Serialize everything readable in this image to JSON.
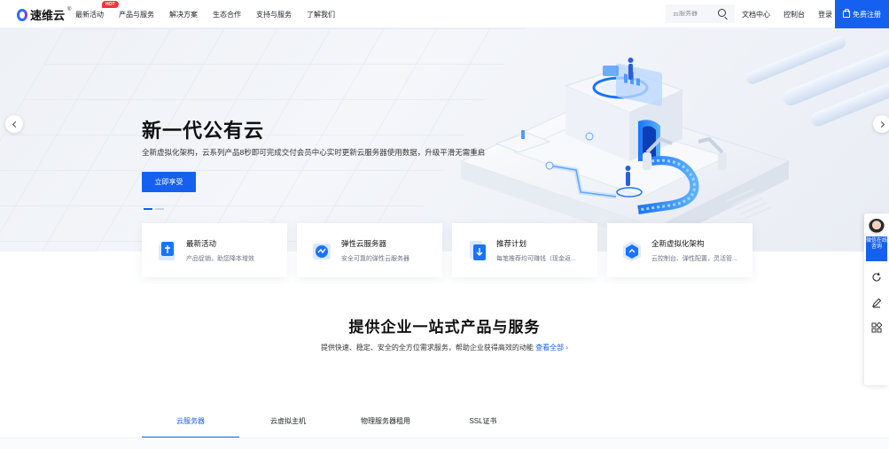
{
  "header": {
    "logo_text": "速维云",
    "logo_mark": "®",
    "nav": [
      {
        "label": "最新活动",
        "badge": "HOT"
      },
      {
        "label": "产品与服务",
        "badge": null
      },
      {
        "label": "解决方案",
        "badge": null
      },
      {
        "label": "生态合作",
        "badge": null
      },
      {
        "label": "支持与服务",
        "badge": null
      },
      {
        "label": "了解我们",
        "badge": null
      }
    ],
    "search_placeholder": "云服务器",
    "docs_label": "文档中心",
    "console_label": "控制台",
    "login_label": "登录",
    "register_label": "免费注册"
  },
  "hero": {
    "title": "新一代公有云",
    "subtitle": "全新虚拟化架构，云系列产品8秒即可完成交付会员中心实时更新云服务器使用数据，升级平滑无需重启",
    "button_label": "立即享受",
    "slide_count": 2,
    "active_slide": 0
  },
  "cards": [
    {
      "title": "最新活动",
      "desc": "产品促销，助您降本增效",
      "icon": "gift-box-icon"
    },
    {
      "title": "弹性云服务器",
      "desc": "安全可靠的弹性云服务器",
      "icon": "cloud-server-icon"
    },
    {
      "title": "推荐计划",
      "desc": "每笔推荐均可赚钱（现金返...",
      "icon": "document-download-icon"
    },
    {
      "title": "全新虚拟化架构",
      "desc": "云控制台、弹性配置，灵活管...",
      "icon": "virtualization-icon"
    }
  ],
  "section": {
    "title": "提供企业一站式产品与服务",
    "subtitle": "提供快速、稳定、安全的全方位需求服务，帮助企业获得高效的动能",
    "link_label": "查看全部 ›"
  },
  "tabs": [
    {
      "label": "云服务器",
      "active": true
    },
    {
      "label": "云虚拟主机",
      "active": false
    },
    {
      "label": "物理服务器租用",
      "active": false
    },
    {
      "label": "SSL证书",
      "active": false
    }
  ],
  "float_bar": {
    "service_label": "微信在线咨询",
    "items": [
      "refresh-icon",
      "edit-icon",
      "grid-apps-icon"
    ]
  },
  "colors": {
    "accent": "#1660f0",
    "hot_badge": "#f0353b"
  }
}
